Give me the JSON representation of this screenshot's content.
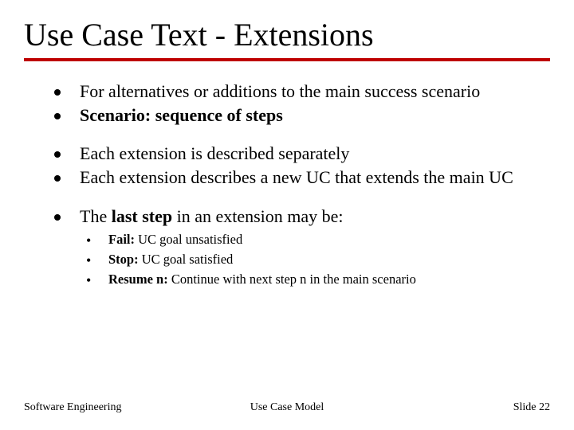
{
  "title": "Use Case Text - Extensions",
  "groups": [
    {
      "items": [
        {
          "text": "For alternatives or additions to the main success scenario"
        },
        {
          "html": "<b>Scenario: sequence of steps</b>"
        }
      ]
    },
    {
      "items": [
        {
          "text": "Each extension is described separately"
        },
        {
          "text": "Each extension describes a new UC that extends the main UC"
        }
      ]
    },
    {
      "items": [
        {
          "html": "The <b>last step</b> in an extension may be:"
        }
      ],
      "subitems": [
        {
          "lead": "Fail:",
          "rest": " UC goal unsatisfied"
        },
        {
          "lead": "Stop:",
          "rest": " UC goal satisfied"
        },
        {
          "lead": "Resume n:",
          "rest": " Continue with next step n in the main scenario"
        }
      ]
    }
  ],
  "footer": {
    "left": "Software Engineering",
    "center": "Use Case Model",
    "right": "Slide  22"
  }
}
